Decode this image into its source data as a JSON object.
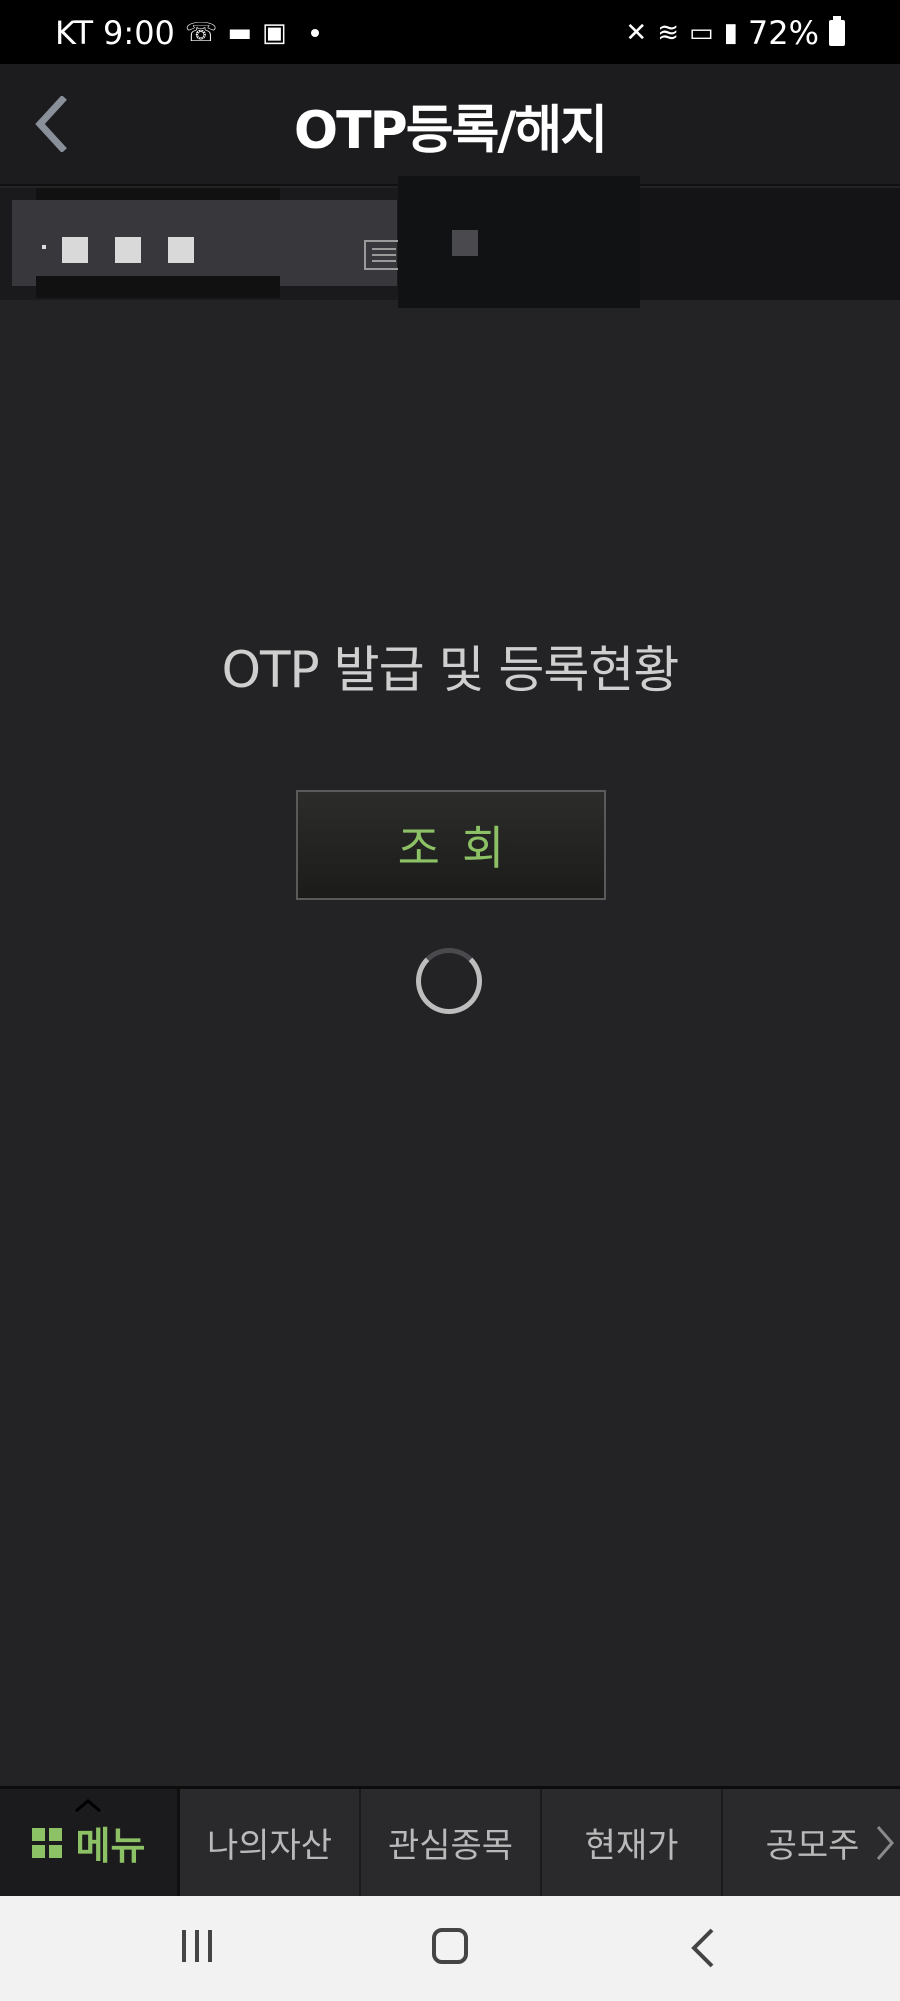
{
  "status_bar": {
    "carrier": "KT",
    "time": "9:00",
    "battery": "72%",
    "icons": [
      "wifi-calling-icon",
      "message-icon",
      "gallery-icon",
      "mute-icon",
      "wifi-icon",
      "hd-icon",
      "signal-icon",
      "battery-icon"
    ]
  },
  "header": {
    "title": "OTP등록/해지"
  },
  "content": {
    "heading": "OTP 발급 및 등록현황",
    "query_button": "조회"
  },
  "bottom_nav": {
    "menu_label": "메뉴",
    "tabs": [
      "나의자산",
      "관심종목",
      "현재가",
      "공모주"
    ]
  },
  "colors": {
    "accent": "#8cc265",
    "background": "#232326",
    "header": "#1c1c1f"
  }
}
